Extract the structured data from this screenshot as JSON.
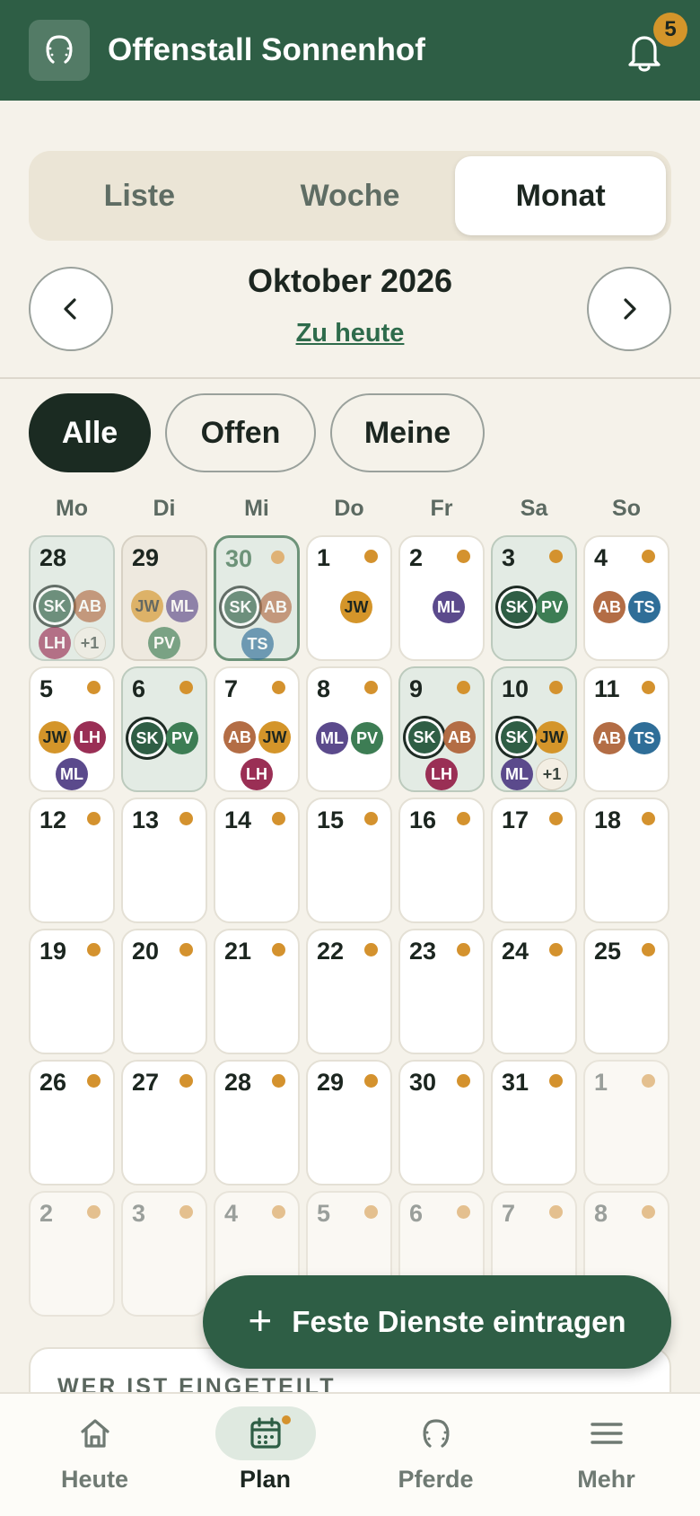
{
  "header": {
    "title": "Offenstall Sonnenhof",
    "notification_count": "5"
  },
  "view_switch": {
    "items": [
      {
        "label": "Liste",
        "active": false
      },
      {
        "label": "Woche",
        "active": false
      },
      {
        "label": "Monat",
        "active": true
      }
    ]
  },
  "month_nav": {
    "title": "Oktober 2026",
    "today_link": "Zu heute"
  },
  "filters": [
    {
      "label": "Alle",
      "active": true
    },
    {
      "label": "Offen",
      "active": false
    },
    {
      "label": "Meine",
      "active": false
    }
  ],
  "weekdays": [
    "Mo",
    "Di",
    "Mi",
    "Do",
    "Fr",
    "Sa",
    "So"
  ],
  "colors": {
    "primary": "#2e5e45",
    "accent": "#d4922e",
    "SK": "#2f5e45",
    "AB": "#b36d45",
    "JW": "#d4952a",
    "ML": "#5b4a8c",
    "PV": "#3d7d54",
    "LH": "#9a2f55",
    "TS": "#2f6e98"
  },
  "calendar": {
    "days": [
      {
        "day": "28",
        "state": "past",
        "dot": false,
        "people": [
          "SK",
          "AB",
          "LH",
          "+1"
        ]
      },
      {
        "day": "29",
        "state": "past",
        "dot": false,
        "people": [
          "JW",
          "ML",
          "PV"
        ]
      },
      {
        "day": "30",
        "state": "today",
        "dot": true,
        "people": [
          "SK",
          "AB",
          "TS"
        ]
      },
      {
        "day": "1",
        "state": "normal",
        "dot": true,
        "people": [
          "JW"
        ]
      },
      {
        "day": "2",
        "state": "normal",
        "dot": true,
        "people": [
          "ML"
        ]
      },
      {
        "day": "3",
        "state": "mine",
        "dot": true,
        "people": [
          "SK",
          "PV"
        ]
      },
      {
        "day": "4",
        "state": "normal",
        "dot": true,
        "people": [
          "AB",
          "TS"
        ]
      },
      {
        "day": "5",
        "state": "normal",
        "dot": true,
        "people": [
          "JW",
          "LH",
          "ML"
        ]
      },
      {
        "day": "6",
        "state": "mine",
        "dot": true,
        "people": [
          "SK",
          "PV"
        ]
      },
      {
        "day": "7",
        "state": "normal",
        "dot": true,
        "people": [
          "AB",
          "JW",
          "LH"
        ]
      },
      {
        "day": "8",
        "state": "normal",
        "dot": true,
        "people": [
          "ML",
          "PV"
        ]
      },
      {
        "day": "9",
        "state": "mine",
        "dot": true,
        "people": [
          "SK",
          "AB",
          "LH"
        ]
      },
      {
        "day": "10",
        "state": "mine",
        "dot": true,
        "people": [
          "SK",
          "JW",
          "ML",
          "+1"
        ]
      },
      {
        "day": "11",
        "state": "normal",
        "dot": true,
        "people": [
          "AB",
          "TS"
        ]
      },
      {
        "day": "12",
        "state": "normal",
        "dot": true,
        "people": []
      },
      {
        "day": "13",
        "state": "normal",
        "dot": true,
        "people": []
      },
      {
        "day": "14",
        "state": "normal",
        "dot": true,
        "people": []
      },
      {
        "day": "15",
        "state": "normal",
        "dot": true,
        "people": []
      },
      {
        "day": "16",
        "state": "normal",
        "dot": true,
        "people": []
      },
      {
        "day": "17",
        "state": "normal",
        "dot": true,
        "people": []
      },
      {
        "day": "18",
        "state": "normal",
        "dot": true,
        "people": []
      },
      {
        "day": "19",
        "state": "normal",
        "dot": true,
        "people": []
      },
      {
        "day": "20",
        "state": "normal",
        "dot": true,
        "people": []
      },
      {
        "day": "21",
        "state": "normal",
        "dot": true,
        "people": []
      },
      {
        "day": "22",
        "state": "normal",
        "dot": true,
        "people": []
      },
      {
        "day": "23",
        "state": "normal",
        "dot": true,
        "people": []
      },
      {
        "day": "24",
        "state": "normal",
        "dot": true,
        "people": []
      },
      {
        "day": "25",
        "state": "normal",
        "dot": true,
        "people": []
      },
      {
        "day": "26",
        "state": "normal",
        "dot": true,
        "people": []
      },
      {
        "day": "27",
        "state": "normal",
        "dot": true,
        "people": []
      },
      {
        "day": "28",
        "state": "normal",
        "dot": true,
        "people": []
      },
      {
        "day": "29",
        "state": "normal",
        "dot": true,
        "people": []
      },
      {
        "day": "30",
        "state": "normal",
        "dot": true,
        "people": []
      },
      {
        "day": "31",
        "state": "normal",
        "dot": true,
        "people": []
      },
      {
        "day": "1",
        "state": "other",
        "dot": true,
        "people": []
      },
      {
        "day": "2",
        "state": "other",
        "dot": true,
        "people": []
      },
      {
        "day": "3",
        "state": "other",
        "dot": true,
        "people": []
      },
      {
        "day": "4",
        "state": "other",
        "dot": true,
        "people": []
      },
      {
        "day": "5",
        "state": "other",
        "dot": true,
        "people": []
      },
      {
        "day": "6",
        "state": "other",
        "dot": true,
        "people": []
      },
      {
        "day": "7",
        "state": "other",
        "dot": true,
        "people": []
      },
      {
        "day": "8",
        "state": "other",
        "dot": true,
        "people": []
      }
    ]
  },
  "fab": {
    "label": "Feste Dienste eintragen"
  },
  "section": {
    "who_title": "WER IST EINGETEILT"
  },
  "tabbar": {
    "items": [
      {
        "label": "Heute",
        "icon": "home-icon"
      },
      {
        "label": "Plan",
        "icon": "calendar-icon",
        "active": true
      },
      {
        "label": "Pferde",
        "icon": "horseshoe-icon"
      },
      {
        "label": "Mehr",
        "icon": "menu-icon"
      }
    ]
  }
}
